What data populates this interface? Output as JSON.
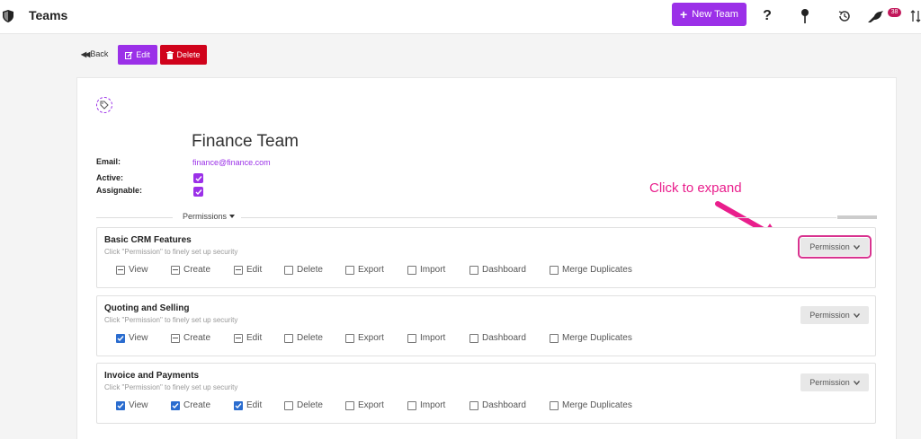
{
  "header": {
    "title": "Teams",
    "new_team_label": "New Team",
    "help_glyph": "?",
    "notification_count": "38"
  },
  "actions": {
    "back_label": "Back",
    "edit_label": "Edit",
    "delete_label": "Delete"
  },
  "team": {
    "name": "Finance Team",
    "email_label": "Email:",
    "email_value": "finance@finance.com",
    "active_label": "Active:",
    "assignable_label": "Assignable:",
    "active": true,
    "assignable": true
  },
  "annotation": {
    "callout": "Click to expand",
    "color": "#e91e8c"
  },
  "permissions": {
    "title": "Permissions",
    "option_labels": [
      "View",
      "Create",
      "Edit",
      "Delete",
      "Export",
      "Import",
      "Dashboard",
      "Merge Duplicates"
    ],
    "sections": [
      {
        "title": "Basic CRM Features",
        "subtitle": "Click \"Permission\" to finely set up security",
        "button_label": "Permission",
        "states": [
          "partial",
          "partial",
          "partial",
          "unchecked",
          "unchecked",
          "unchecked",
          "unchecked",
          "unchecked"
        ]
      },
      {
        "title": "Quoting and Selling",
        "subtitle": "Click \"Permission\" to finely set up security",
        "button_label": "Permission",
        "states": [
          "checked",
          "partial",
          "partial",
          "unchecked",
          "unchecked",
          "unchecked",
          "unchecked",
          "unchecked"
        ]
      },
      {
        "title": "Invoice and Payments",
        "subtitle": "Click \"Permission\" to finely set up security",
        "button_label": "Permission",
        "states": [
          "checked",
          "checked",
          "checked",
          "unchecked",
          "unchecked",
          "unchecked",
          "unchecked",
          "unchecked"
        ]
      }
    ]
  },
  "colors": {
    "accent": "#9b30e8",
    "danger": "#d0021b",
    "checked": "#2a6ccf",
    "badge": "#c2185b"
  },
  "icons": [
    "shield-icon",
    "help-icon",
    "pin-icon",
    "history-icon",
    "bird-icon",
    "sort-icon",
    "back-arrow-icon",
    "edit-icon",
    "trash-icon",
    "tag-icon",
    "check-icon",
    "chevron-down-icon"
  ]
}
